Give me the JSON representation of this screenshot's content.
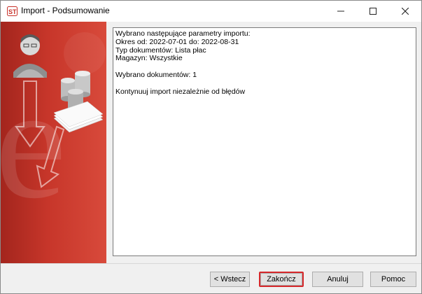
{
  "window": {
    "title": "Import - Podsumowanie",
    "icons": {
      "app": "app-logo-icon",
      "minimize": "minimize-icon",
      "maximize": "maximize-icon",
      "close": "close-icon"
    }
  },
  "side_panel": {
    "illustration": [
      "person-avatar-icon",
      "coin-stacks-icon",
      "document-stack-icon",
      "arrow-down-icon"
    ]
  },
  "summary": {
    "lines": [
      "Wybrano następujące parametry importu:",
      "Okres od: 2022-07-01 do: 2022-08-31",
      "Typ dokumentów: Lista płac",
      "Magazyn: Wszystkie",
      "",
      "Wybrano dokumentów: 1",
      "",
      "Kontynuuj import niezależnie od błędów"
    ]
  },
  "buttons": {
    "back": "< Wstecz",
    "finish": "Zakończ",
    "cancel": "Anuluj",
    "help": "Pomoc"
  },
  "colors": {
    "accent_highlight": "#d6282b",
    "panel_red": "#c7362a"
  }
}
